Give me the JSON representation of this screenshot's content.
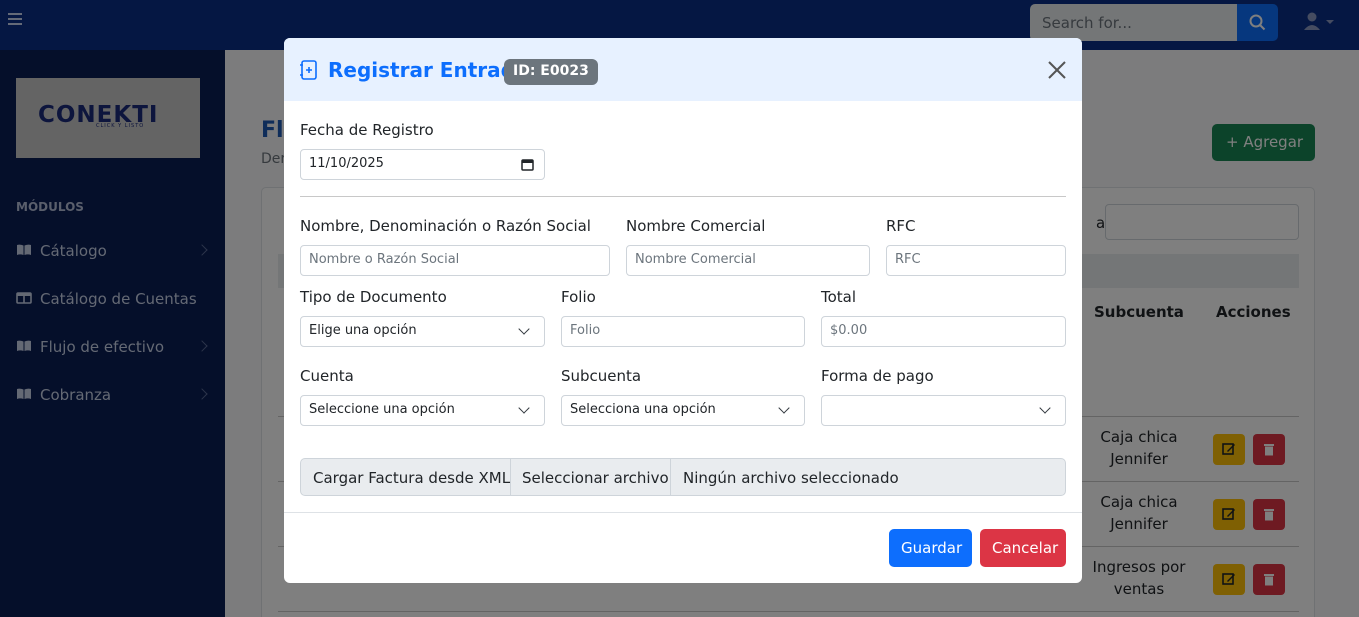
{
  "navbar": {
    "search_placeholder": "Search for..."
  },
  "sidebar": {
    "logo_text": "CONEKTI",
    "logo_tagline": "CLICK Y LISTO",
    "section_heading": "MÓDULOS",
    "items": [
      {
        "label": "Cátalogo",
        "icon": "book-icon",
        "has_submenu": true
      },
      {
        "label": "Catálogo de Cuentas",
        "icon": "columns-icon",
        "has_submenu": false
      },
      {
        "label": "Flujo de efectivo",
        "icon": "book-icon",
        "has_submenu": true
      },
      {
        "label": "Cobranza",
        "icon": "book-icon",
        "has_submenu": true
      }
    ]
  },
  "page": {
    "title_partial": "Flu",
    "subtitle_partial": "Der",
    "add_button": "+ Agregar",
    "filter_label_partial": "ar:",
    "table": {
      "headers": [
        "Subcuenta",
        "Acciones"
      ],
      "rows": [
        {
          "subcuenta": [
            "Caja chica",
            "Jennifer"
          ]
        },
        {
          "subcuenta": [
            "Caja chica",
            "Jennifer"
          ]
        },
        {
          "subcuenta": [
            "Ingresos por",
            "ventas"
          ]
        }
      ]
    }
  },
  "modal": {
    "title": "Registrar Entrada",
    "badge": "ID: E0023",
    "fecha_label": "Fecha de Registro",
    "fecha_value": "11/10/2025",
    "nombre_label": "Nombre, Denominación o Razón Social",
    "nombre_placeholder": "Nombre o Razón Social",
    "comercial_label": "Nombre Comercial",
    "comercial_placeholder": "Nombre Comercial",
    "rfc_label": "RFC",
    "rfc_placeholder": "RFC",
    "tipo_label": "Tipo de Documento",
    "tipo_value": "Elige una opción",
    "folio_label": "Folio",
    "folio_placeholder": "Folio",
    "total_label": "Total",
    "total_placeholder": "$0.00",
    "cuenta_label": "Cuenta",
    "cuenta_value": "Seleccione una opción",
    "subcuenta_label": "Subcuenta",
    "subcuenta_value": "Selecciona una opción",
    "forma_label": "Forma de pago",
    "forma_value": "",
    "xml_label": "Cargar Factura desde XML",
    "file_button": "Seleccionar archivo",
    "file_status": "Ningún archivo seleccionado",
    "save_button": "Guardar",
    "cancel_button": "Cancelar"
  },
  "colors": {
    "navbar": "#0a2f86",
    "sidebar": "#0a1e55",
    "primary": "#0d6efd",
    "danger": "#dc3545",
    "warning": "#ffc107",
    "success": "#198754"
  }
}
